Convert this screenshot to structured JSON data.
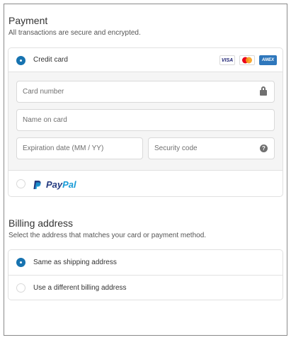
{
  "payment": {
    "title": "Payment",
    "subtitle": "All transactions are secure and encrypted.",
    "credit_card": {
      "label": "Credit card",
      "selected": true,
      "brands": [
        "VISA",
        "MC",
        "AMEX"
      ],
      "card_number_placeholder": "Card number",
      "name_placeholder": "Name on card",
      "expiration_placeholder": "Expiration date (MM / YY)",
      "security_placeholder": "Security code",
      "help_glyph": "?"
    },
    "paypal": {
      "label_pay": "Pay",
      "label_pal": "Pal",
      "selected": false
    }
  },
  "billing": {
    "title": "Billing address",
    "subtitle": "Select the address that matches your card or payment method.",
    "options": [
      {
        "label": "Same as shipping address",
        "selected": true
      },
      {
        "label": "Use a different billing address",
        "selected": false
      }
    ]
  },
  "colors": {
    "accent": "#1773b0",
    "paypal_dark": "#253b80",
    "paypal_light": "#179bd7",
    "amex": "#2e77bc"
  }
}
